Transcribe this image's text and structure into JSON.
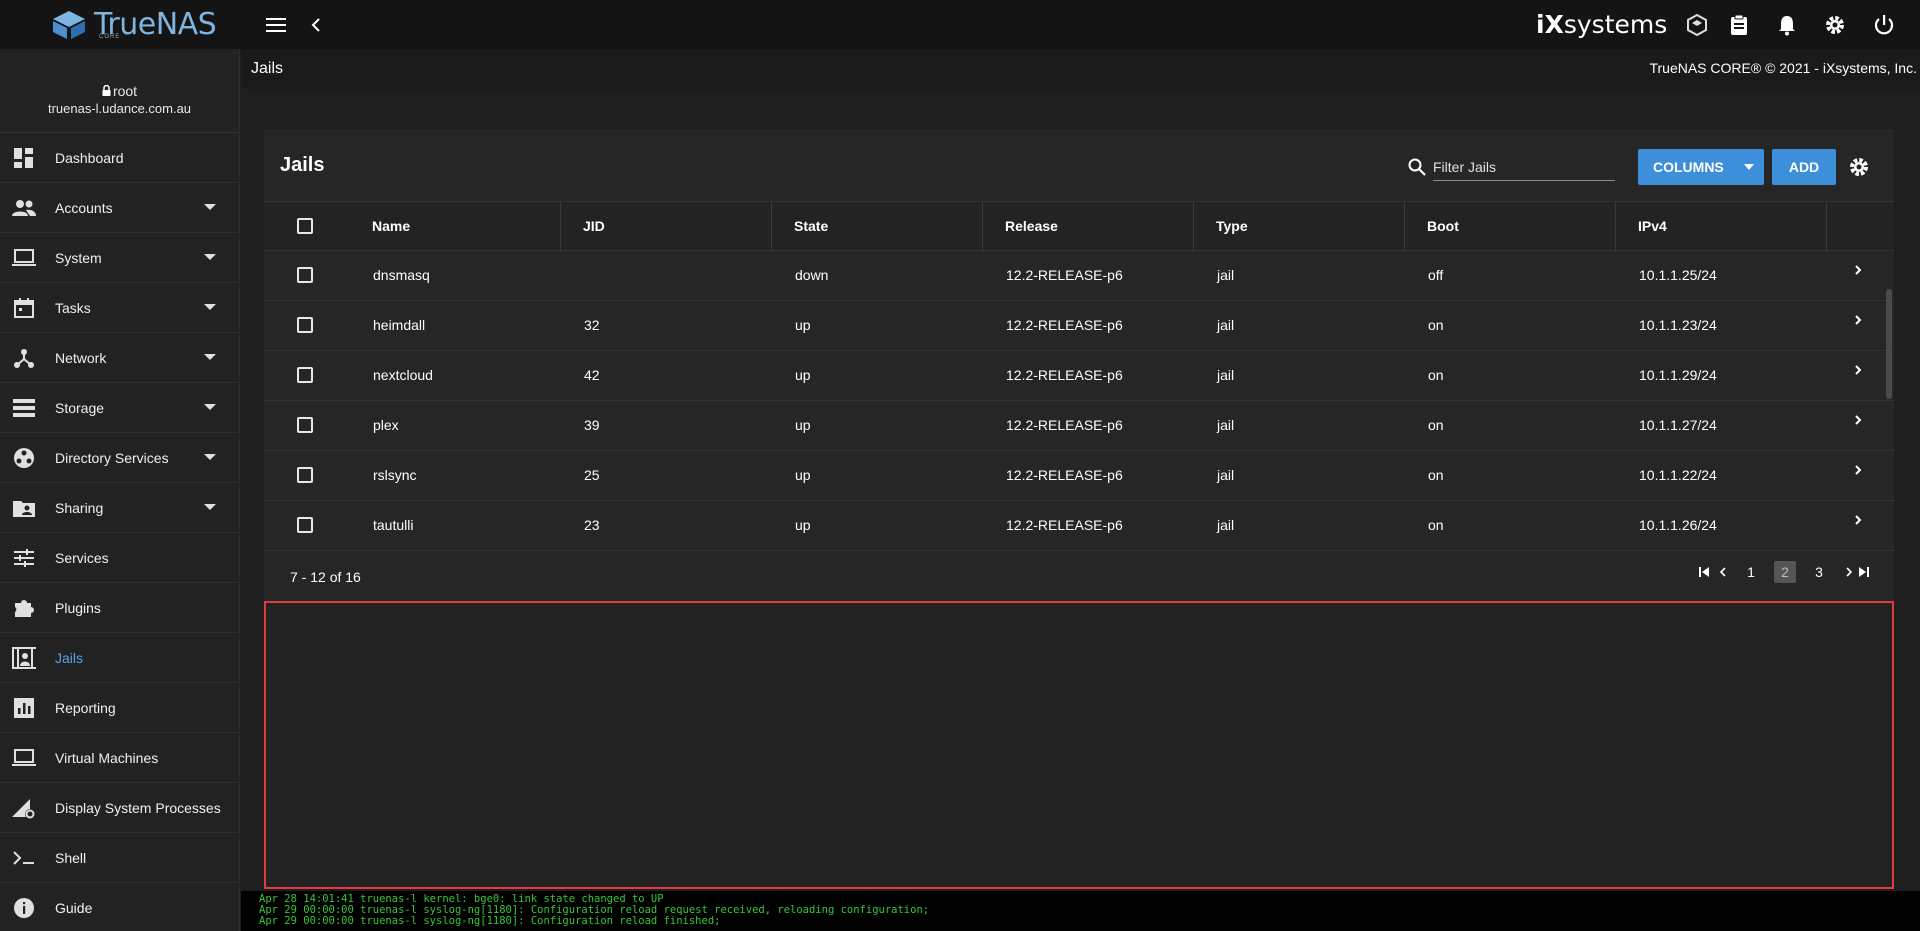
{
  "app": {
    "brand": "TrueNAS",
    "brand_sub": "CORE",
    "vendor": "systems",
    "vendor_mark": "iX"
  },
  "user": {
    "name": "root",
    "host": "truenas-l.udance.com.au"
  },
  "sidebar": {
    "items": [
      {
        "label": "Dashboard",
        "icon": "dashboard-icon",
        "expandable": false
      },
      {
        "label": "Accounts",
        "icon": "people-icon",
        "expandable": true
      },
      {
        "label": "System",
        "icon": "laptop-icon",
        "expandable": true
      },
      {
        "label": "Tasks",
        "icon": "calendar-icon",
        "expandable": true
      },
      {
        "label": "Network",
        "icon": "network-icon",
        "expandable": true
      },
      {
        "label": "Storage",
        "icon": "storage-icon",
        "expandable": true
      },
      {
        "label": "Directory Services",
        "icon": "directory-icon",
        "expandable": true
      },
      {
        "label": "Sharing",
        "icon": "folder-shared-icon",
        "expandable": true
      },
      {
        "label": "Services",
        "icon": "tune-icon",
        "expandable": false
      },
      {
        "label": "Plugins",
        "icon": "puzzle-icon",
        "expandable": false
      },
      {
        "label": "Jails",
        "icon": "jail-icon",
        "expandable": false,
        "active": true
      },
      {
        "label": "Reporting",
        "icon": "chart-icon",
        "expandable": false
      },
      {
        "label": "Virtual Machines",
        "icon": "computer-icon",
        "expandable": false
      },
      {
        "label": "Display System Processes",
        "icon": "processes-icon",
        "expandable": false
      },
      {
        "label": "Shell",
        "icon": "shell-icon",
        "expandable": false
      },
      {
        "label": "Guide",
        "icon": "info-icon",
        "expandable": false
      }
    ]
  },
  "page": {
    "title": "Jails",
    "copyright": "TrueNAS CORE® © 2021 - iXsystems, Inc."
  },
  "card": {
    "title": "Jails",
    "filter_placeholder": "Filter Jails",
    "columns_label": "COLUMNS",
    "add_label": "ADD"
  },
  "table": {
    "columns": [
      "Name",
      "JID",
      "State",
      "Release",
      "Type",
      "Boot",
      "IPv4"
    ],
    "rows": [
      {
        "name": "dnsmasq",
        "jid": "",
        "state": "down",
        "release": "12.2-RELEASE-p6",
        "type": "jail",
        "boot": "off",
        "ipv4": "10.1.1.25/24"
      },
      {
        "name": "heimdall",
        "jid": "32",
        "state": "up",
        "release": "12.2-RELEASE-p6",
        "type": "jail",
        "boot": "on",
        "ipv4": "10.1.1.23/24"
      },
      {
        "name": "nextcloud",
        "jid": "42",
        "state": "up",
        "release": "12.2-RELEASE-p6",
        "type": "jail",
        "boot": "on",
        "ipv4": "10.1.1.29/24"
      },
      {
        "name": "plex",
        "jid": "39",
        "state": "up",
        "release": "12.2-RELEASE-p6",
        "type": "jail",
        "boot": "on",
        "ipv4": "10.1.1.27/24"
      },
      {
        "name": "rslsync",
        "jid": "25",
        "state": "up",
        "release": "12.2-RELEASE-p6",
        "type": "jail",
        "boot": "on",
        "ipv4": "10.1.1.22/24"
      },
      {
        "name": "tautulli",
        "jid": "23",
        "state": "up",
        "release": "12.2-RELEASE-p6",
        "type": "jail",
        "boot": "on",
        "ipv4": "10.1.1.26/24"
      }
    ]
  },
  "pagination": {
    "info": "7 - 12 of 16",
    "pages": [
      "1",
      "2",
      "3"
    ],
    "current": "2"
  },
  "console": {
    "lines": [
      "Apr 28 14:01:41 truenas-l kernel: bge0: link state changed to UP",
      "Apr 29 00:00:00 truenas-l syslog-ng[1180]: Configuration reload request received, reloading configuration;",
      "Apr 29 00:00:00 truenas-l syslog-ng[1180]: Configuration reload finished;"
    ]
  },
  "colors": {
    "accent": "#3c8fd8",
    "active_nav": "#5aa2e6",
    "highlight_border": "#e23b3b",
    "console_text": "#35c735"
  }
}
